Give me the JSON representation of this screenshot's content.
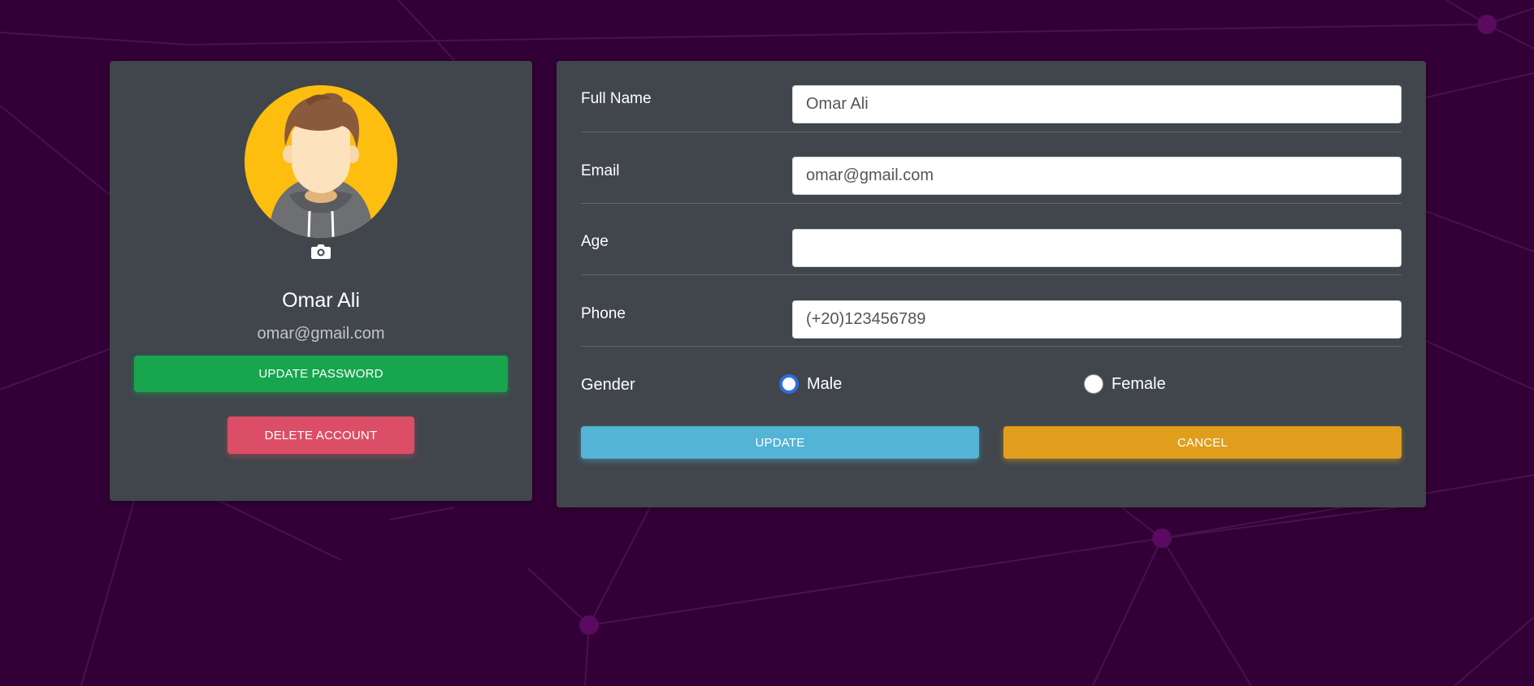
{
  "profile": {
    "name": "Omar Ali",
    "email": "omar@gmail.com",
    "update_password_label": "UPDATE PASSWORD",
    "delete_account_label": "DELETE ACCOUNT"
  },
  "form": {
    "full_name": {
      "label": "Full Name",
      "value": "Omar Ali"
    },
    "email": {
      "label": "Email",
      "value": "omar@gmail.com"
    },
    "age": {
      "label": "Age",
      "value": ""
    },
    "phone": {
      "label": "Phone",
      "value": "(+20)123456789"
    },
    "gender": {
      "label": "Gender",
      "options": [
        {
          "label": "Male",
          "checked": true
        },
        {
          "label": "Female",
          "checked": false
        }
      ]
    },
    "update_label": "UPDATE",
    "cancel_label": "CANCEL"
  },
  "colors": {
    "background": "#320036",
    "card": "#40464c",
    "update_password": "#17a54e",
    "delete_account": "#dc4e65",
    "update": "#53b4d5",
    "cancel": "#e09e1c",
    "avatar_bg": "#fdbe0f"
  },
  "icons": {
    "camera": "camera-icon"
  }
}
